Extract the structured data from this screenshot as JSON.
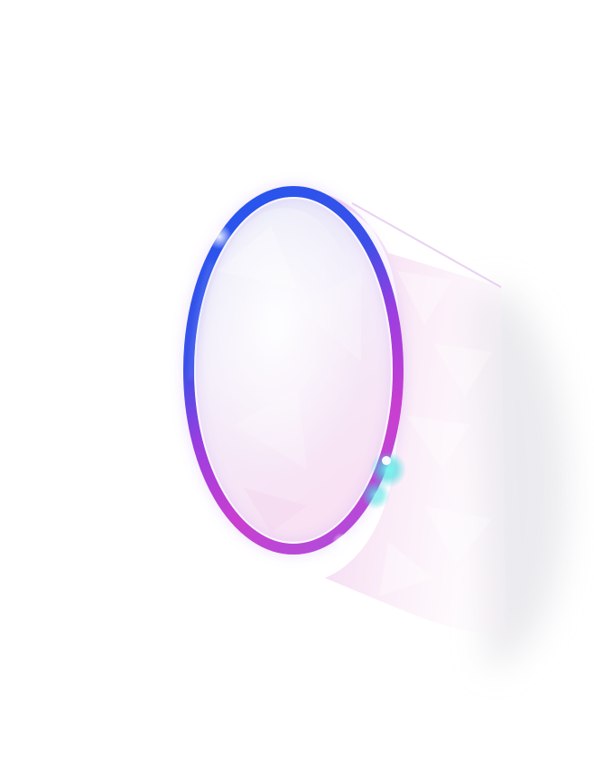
{
  "glyph": {
    "character": "0",
    "colors": {
      "background": "#ffffff",
      "ring_top": "#2a5cf0",
      "ring_mid": "#a23de0",
      "ring_bottom": "#c040d0",
      "highlight_cyan": "#3ee0e0",
      "shadow_tint": "#f3d8f0",
      "inner_tint_top": "#e9ecf8",
      "inner_tint_bottom": "#f7e4f4"
    }
  }
}
